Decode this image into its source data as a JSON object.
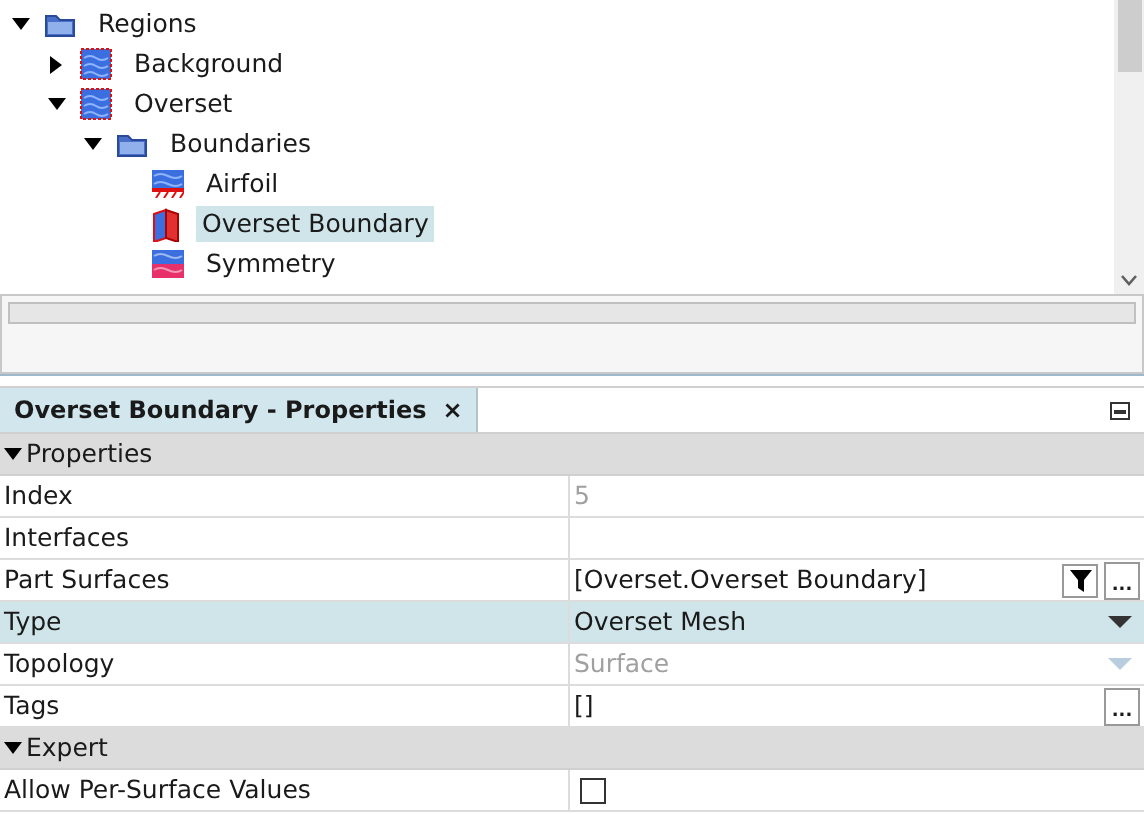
{
  "tree": [
    {
      "label": "Regions",
      "kind": "folder",
      "expanded": true,
      "selected": false,
      "children": [
        {
          "label": "Background",
          "kind": "region",
          "expanded": false,
          "selected": false
        },
        {
          "label": "Overset",
          "kind": "region",
          "expanded": true,
          "selected": false,
          "children": [
            {
              "label": "Boundaries",
              "kind": "folder",
              "expanded": true,
              "selected": false,
              "children": [
                {
                  "label": "Airfoil",
                  "kind": "wall",
                  "selected": false
                },
                {
                  "label": "Overset Boundary",
                  "kind": "overset",
                  "selected": true
                },
                {
                  "label": "Symmetry",
                  "kind": "symmetry",
                  "selected": false
                }
              ]
            }
          ]
        }
      ]
    }
  ],
  "panel_tab": {
    "title": "Overset Boundary - Properties",
    "close": "×"
  },
  "properties": [
    {
      "kind": "section",
      "label": "Properties",
      "expanded": true
    },
    {
      "kind": "row",
      "label": "Index",
      "value": "5",
      "disabled": true,
      "selected": false
    },
    {
      "kind": "row",
      "label": "Interfaces",
      "selected": false
    },
    {
      "kind": "row",
      "label": "Part Surfaces",
      "value": "[Overset.Overset Boundary]",
      "filter": true,
      "more": "...",
      "selected": false
    },
    {
      "kind": "dropdown",
      "label": "Type",
      "value": "Overset Mesh",
      "disabled": false,
      "selected": true
    },
    {
      "kind": "dropdown",
      "label": "Topology",
      "value": "Surface",
      "disabled": true,
      "selected": false
    },
    {
      "kind": "row",
      "label": "Tags",
      "value": "[]",
      "more": "...",
      "selected": false
    },
    {
      "kind": "section",
      "label": "Expert",
      "expanded": true
    },
    {
      "kind": "checkbox",
      "label": "Allow Per-Surface Values",
      "checked": false,
      "selected": false
    }
  ]
}
